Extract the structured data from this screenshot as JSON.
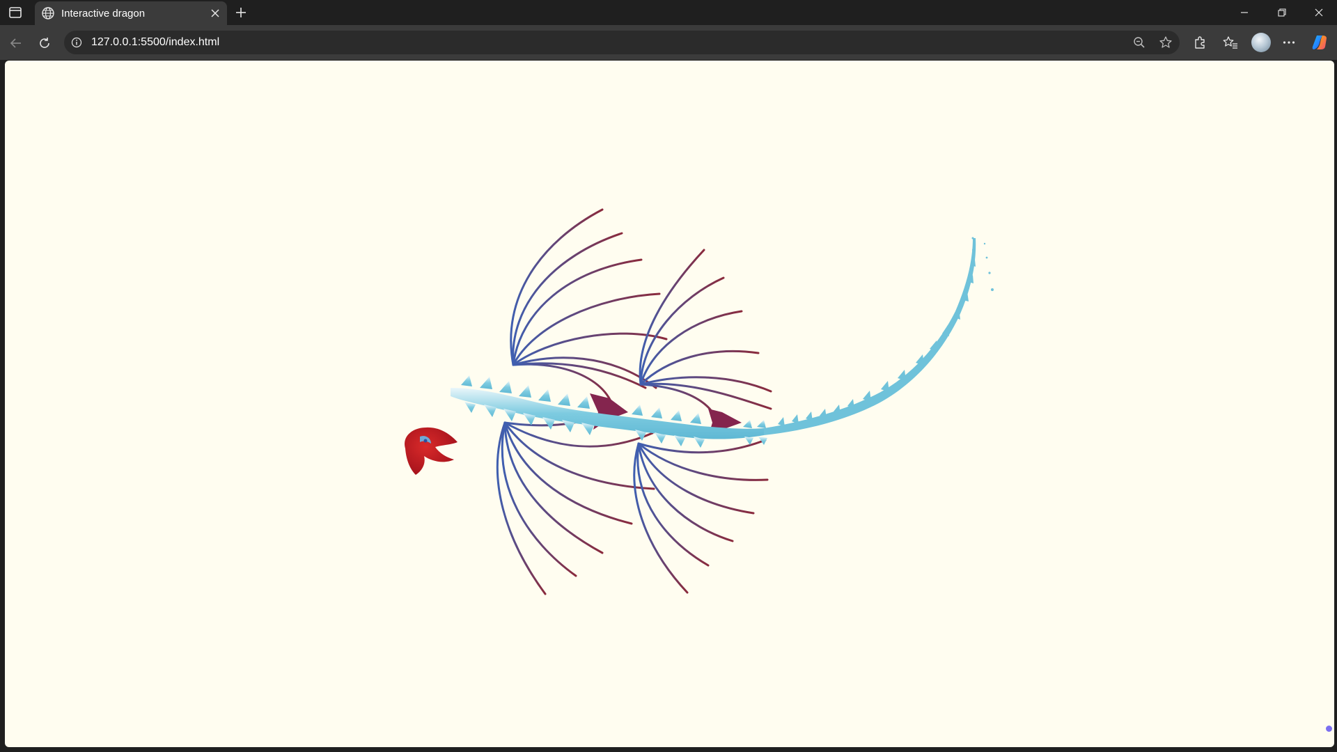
{
  "browser": {
    "tab": {
      "title": "Interactive dragon",
      "icon": "globe-icon"
    },
    "address": {
      "url": "127.0.0.1:5500/index.html",
      "icon": "info-icon"
    },
    "toolbar_icons": [
      "back-arrow-icon",
      "refresh-icon",
      "zoom-out-icon",
      "star-add-icon",
      "extensions-icon",
      "favorites-icon",
      "avatar",
      "more-icon",
      "copilot-icon"
    ],
    "window_controls": [
      "minimize-icon",
      "restore-icon",
      "close-icon"
    ]
  },
  "page": {
    "background": "#fffdf0",
    "dragon": {
      "head_color": "#c0151c",
      "body_color": "#7dcbe0",
      "wing_colors": [
        "#3f5fb0",
        "#8a2a3c"
      ],
      "joint_color": "#84254e"
    }
  }
}
